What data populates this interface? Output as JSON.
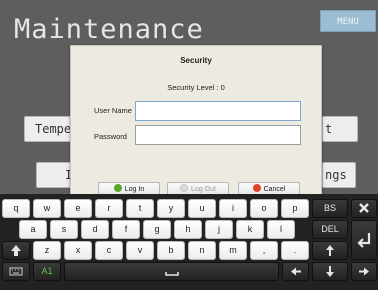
{
  "background": {
    "title": "Maintenance",
    "menu_label": "MENU",
    "buttons": [
      {
        "name": "temperature-button",
        "label": "Tempe"
      },
      {
        "name": "i-button",
        "label": "I"
      },
      {
        "name": "t-button",
        "label": "t"
      },
      {
        "name": "settings-button",
        "label": "ngs"
      }
    ]
  },
  "dialog": {
    "title": "Security",
    "security_level": "Security Level : 0",
    "user_name_label": "User Name",
    "user_name_value": "",
    "password_label": "Password",
    "password_value": "",
    "login_label": "Log In",
    "logout_label": "Log Out",
    "cancel_label": "Cancel"
  },
  "keyboard": {
    "row1": [
      "q",
      "w",
      "e",
      "r",
      "t",
      "y",
      "u",
      "i",
      "o",
      "p"
    ],
    "row2": [
      "a",
      "s",
      "d",
      "f",
      "g",
      "h",
      "j",
      "k",
      "l"
    ],
    "row3": [
      "z",
      "x",
      "c",
      "v",
      "b",
      "n",
      "m",
      ",",
      "."
    ],
    "bs_label": "BS",
    "del_label": "DEL",
    "mode_label": "A1"
  },
  "colors": {
    "accent_green": "#5aa829",
    "cancel_red": "#e0452a",
    "menu_blue": "#9cbcd4"
  }
}
